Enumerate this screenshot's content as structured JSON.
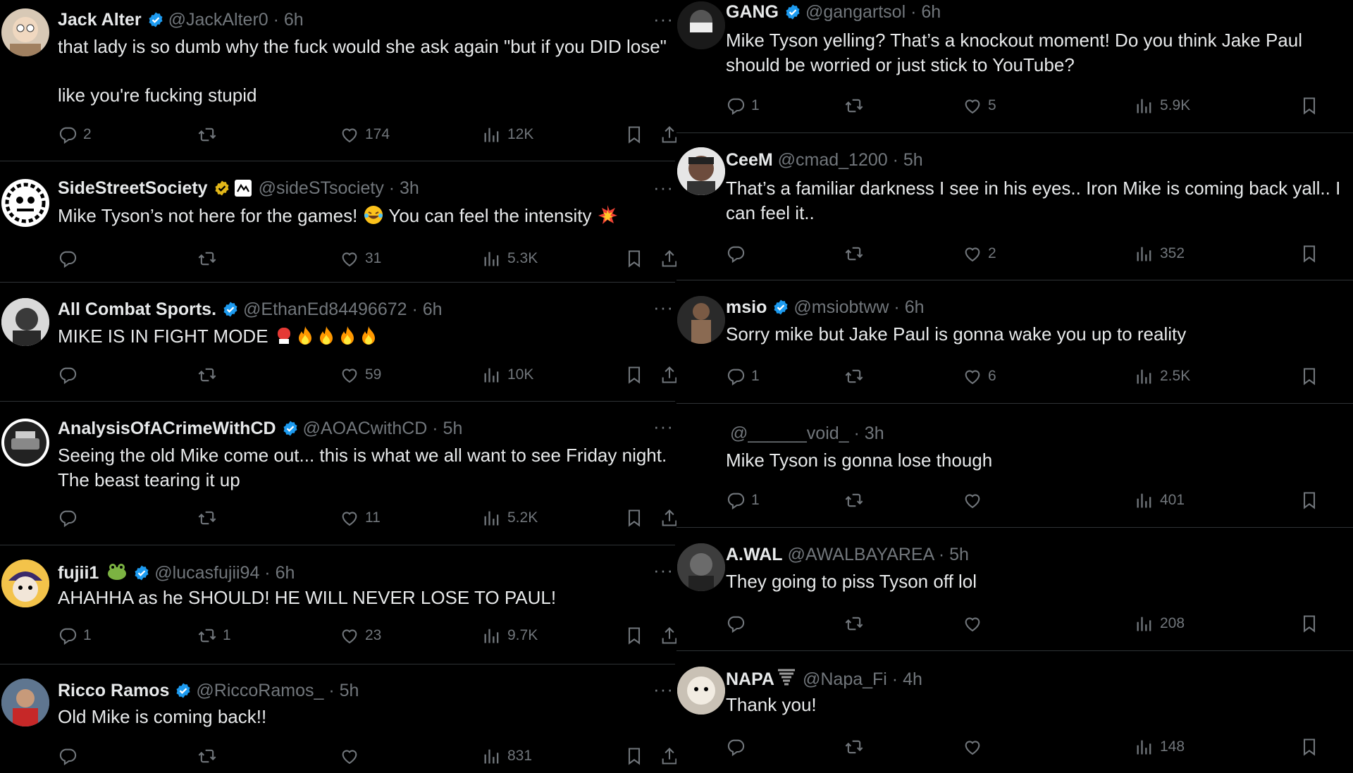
{
  "left_tweets": [
    {
      "name": "Jack Alter",
      "handle": "@JackAlter0 · 6h",
      "text_line1": "that lady is so dumb why the fuck would she ask again \"but if you DID lose\"",
      "text_line2": "like you're fucking stupid",
      "replies": "2",
      "retweets": "",
      "likes": "174",
      "views": "12K"
    },
    {
      "name": "SideStreetSociety",
      "handle": "@sideSTsociety · 3h",
      "text": "Mike Tyson’s not here for the games!",
      "text_mid": "You can feel the intensity",
      "replies": "",
      "retweets": "",
      "likes": "31",
      "views": "5.3K"
    },
    {
      "name": "All Combat Sports.",
      "handle": "@EthanEd84496672 · 6h",
      "text": "MIKE IS IN FIGHT MODE",
      "replies": "",
      "retweets": "",
      "likes": "59",
      "views": "10K"
    },
    {
      "name": "AnalysisOfACrimeWithCD",
      "handle": "@AOACwithCD · 5h",
      "text_line1": "Seeing the old Mike come out... this is what we all want to see Friday night.",
      "text_line2": "The beast tearing it up",
      "replies": "",
      "retweets": "",
      "likes": "11",
      "views": "5.2K"
    },
    {
      "name": "fujii1",
      "handle": "@lucasfujii94 · 6h",
      "text": "AHAHHA as he SHOULD! HE WILL NEVER LOSE TO PAUL!",
      "replies": "1",
      "retweets": "1",
      "likes": "23",
      "views": "9.7K"
    },
    {
      "name": "Ricco Ramos",
      "handle": "@RiccoRamos_ · 5h",
      "text": "Old Mike is coming back!!",
      "replies": "",
      "retweets": "",
      "likes": "",
      "views": "831"
    }
  ],
  "right_tweets": [
    {
      "name": "GANG",
      "handle": "@gangartsol · 6h",
      "text_line1": "Mike Tyson yelling? That’s a knockout moment! Do you think Jake Paul",
      "text_line2": "should be worried or just stick to YouTube?",
      "replies": "1",
      "retweets": "",
      "likes": "5",
      "views": "5.9K"
    },
    {
      "name": "CeeM",
      "handle": "@cmad_1200 · 5h",
      "text_line1": "That’s a familiar darkness I see in his eyes.. Iron Mike is coming back yall.. I",
      "text_line2": "can feel it..",
      "replies": "",
      "retweets": "",
      "likes": "2",
      "views": "352"
    },
    {
      "name": "msio",
      "handle": "@msiobtww · 6h",
      "text": "Sorry mike but Jake Paul is gonna wake you up to reality",
      "replies": "1",
      "retweets": "",
      "likes": "6",
      "views": "2.5K"
    },
    {
      "name": "",
      "handle": "@______void_ · 3h",
      "text": "Mike Tyson is gonna lose though",
      "replies": "1",
      "retweets": "",
      "likes": "",
      "views": "401"
    },
    {
      "name": "A.WAL",
      "handle": "@AWALBAYAREA · 5h",
      "text": "They going to piss Tyson off lol",
      "replies": "",
      "retweets": "",
      "likes": "",
      "views": "208"
    },
    {
      "name": "NAPA",
      "handle": "@Napa_Fi · 4h",
      "text": "Thank you!",
      "replies": "",
      "retweets": "",
      "likes": "",
      "views": "148"
    }
  ],
  "more_label": "···",
  "colors": {
    "background": "#000000",
    "text": "#e7e9ea",
    "muted": "#71767b",
    "verified": "#1d9bf0",
    "gold": "#e2b719"
  },
  "icons": [
    "reply-icon",
    "retweet-icon",
    "like-icon",
    "views-icon",
    "bookmark-icon",
    "share-icon",
    "verified-badge-icon",
    "more-icon"
  ]
}
